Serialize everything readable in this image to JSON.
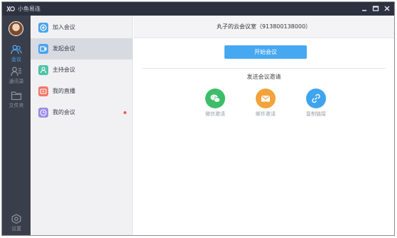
{
  "app": {
    "title": "小鱼易连",
    "window_controls": {
      "minimize_icon": "minimize-icon",
      "maximize_icon": "maximize-icon",
      "close_icon": "close-icon"
    }
  },
  "rail": {
    "items": [
      {
        "label": "会议",
        "icon": "people-icon",
        "active": true
      },
      {
        "label": "通讯录",
        "icon": "contacts-icon",
        "active": false
      },
      {
        "label": "文件夹",
        "icon": "folder-icon",
        "active": false
      }
    ],
    "settings": {
      "label": "设置",
      "icon": "gear-icon"
    }
  },
  "sidebar": {
    "items": [
      {
        "label": "加入会议",
        "icon": "join-meeting-icon",
        "color": "#4aa3ee",
        "active": false
      },
      {
        "label": "发起会议",
        "icon": "start-meeting-icon",
        "color": "#4aa3ee",
        "active": true
      },
      {
        "label": "主持会议",
        "icon": "host-meeting-icon",
        "color": "#4cc4a8",
        "active": false
      },
      {
        "label": "我的直播",
        "icon": "live-icon",
        "color": "#f2786a",
        "active": false
      },
      {
        "label": "我的会议",
        "icon": "my-meetings-icon",
        "color": "#9b8be6",
        "active": false,
        "badge_dot": true
      }
    ]
  },
  "main": {
    "room_title": "丸子的云会议室（913800138000）",
    "start_button": "开始会议",
    "invite_title": "发送会议邀请",
    "share": [
      {
        "label": "微信邀请",
        "icon": "wechat-icon",
        "color": "#3dbd6a"
      },
      {
        "label": "邮件邀请",
        "icon": "mail-icon",
        "color": "#f3a33a"
      },
      {
        "label": "复制链接",
        "icon": "link-icon",
        "color": "#3fa4ee"
      }
    ]
  },
  "colors": {
    "titlebar": "#2e3240",
    "rail": "#3a3e4b",
    "accent": "#46a8f0",
    "sidebar": "#f1f1f3",
    "sidebar_active": "#d7dae1"
  }
}
